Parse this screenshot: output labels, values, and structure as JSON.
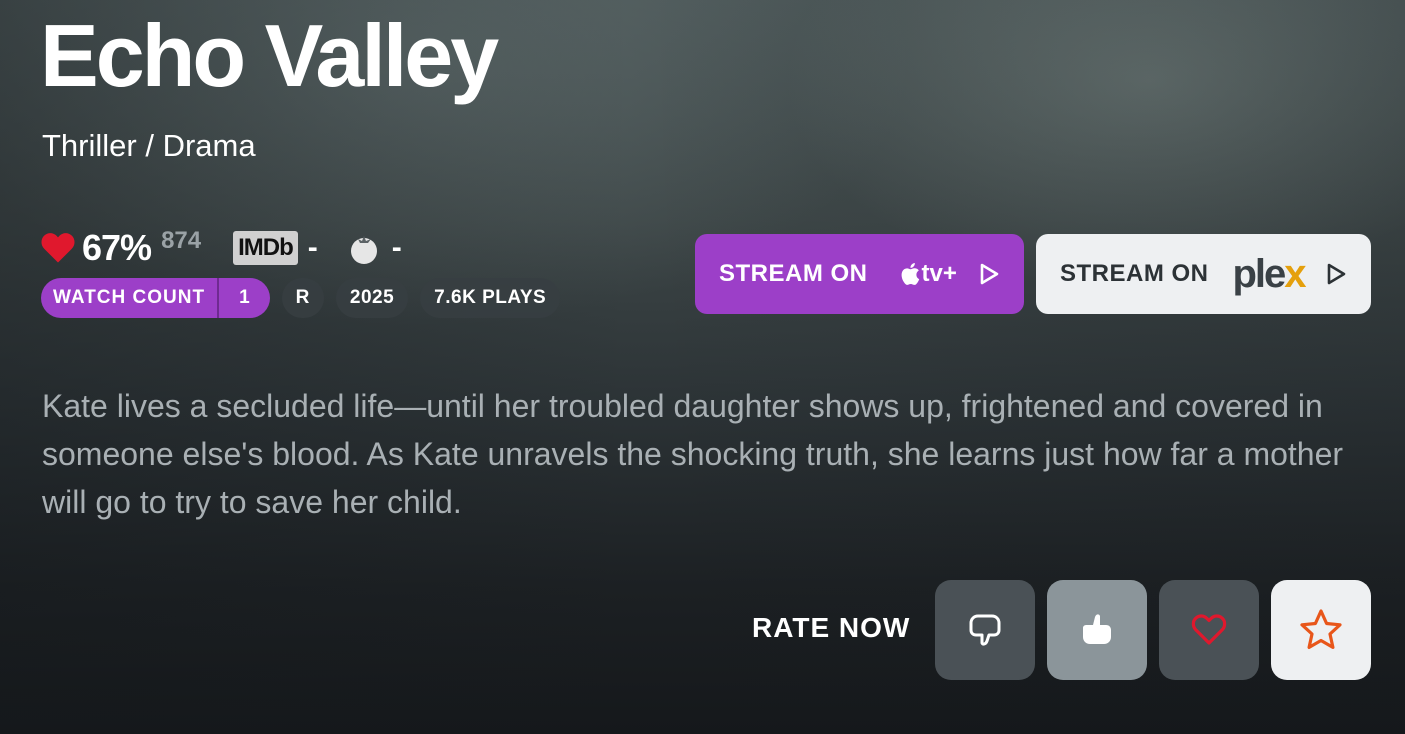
{
  "movie": {
    "title": "Echo Valley",
    "genres": "Thriller / Drama",
    "description": "Kate lives a secluded life—until her troubled daughter shows up, frightened and covered in someone else's blood. As Kate unravels the shocking truth, she learns just how far a mother will go to try to save her child."
  },
  "ratings": {
    "community_score": "67%",
    "community_votes": "874",
    "imdb_label": "IMDb",
    "imdb_value": "-",
    "rotten_value": "-",
    "heart_icon": "heart-icon",
    "tomato_icon": "tomato-icon"
  },
  "badges": {
    "watch_count_label": "WATCH COUNT",
    "watch_count_value": "1",
    "content_rating": "R",
    "year": "2025",
    "plays": "7.6K PLAYS"
  },
  "streaming": {
    "apple": {
      "label": "STREAM ON",
      "provider": "tv+",
      "color": "#9c3fc8"
    },
    "plex": {
      "label": "STREAM ON",
      "provider_main": "ple",
      "provider_accent": "x",
      "accent_color": "#e5a00d"
    }
  },
  "rate": {
    "label": "RATE NOW",
    "buttons": [
      "thumbs-down-icon",
      "thumbs-up-icon",
      "heart-outline-icon",
      "star-icon"
    ]
  },
  "colors": {
    "accent_purple": "#9c3fc8",
    "heart_red": "#e0182d",
    "star_orange": "#e8561a"
  }
}
